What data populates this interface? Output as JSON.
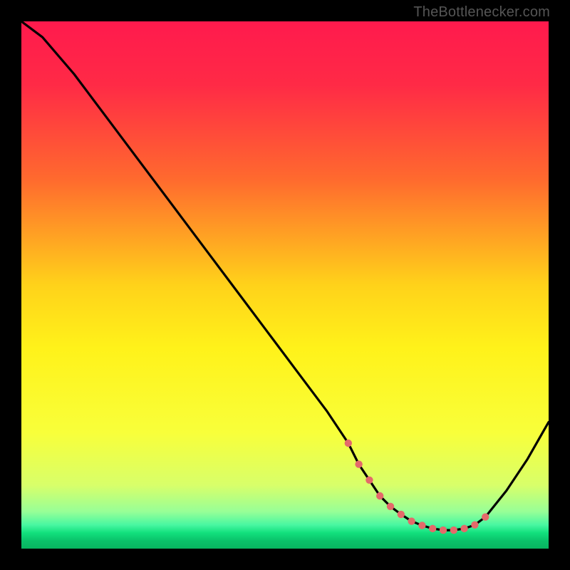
{
  "watermark": "TheBottlenecker.com",
  "chart_data": {
    "type": "line",
    "title": "",
    "xlabel": "",
    "ylabel": "",
    "xlim": [
      0,
      100
    ],
    "ylim": [
      0,
      100
    ],
    "gradient_stops": [
      {
        "pos": 0.0,
        "color": "#ff1a4d"
      },
      {
        "pos": 0.12,
        "color": "#ff2a46"
      },
      {
        "pos": 0.3,
        "color": "#ff6a2e"
      },
      {
        "pos": 0.5,
        "color": "#ffd21a"
      },
      {
        "pos": 0.62,
        "color": "#fff21a"
      },
      {
        "pos": 0.78,
        "color": "#f8ff3a"
      },
      {
        "pos": 0.88,
        "color": "#d8ff6a"
      },
      {
        "pos": 0.93,
        "color": "#97ff97"
      },
      {
        "pos": 0.955,
        "color": "#48f7a1"
      },
      {
        "pos": 0.97,
        "color": "#12e07d"
      },
      {
        "pos": 0.985,
        "color": "#0ac26a"
      },
      {
        "pos": 1.0,
        "color": "#08b560"
      }
    ],
    "series": [
      {
        "name": "curve",
        "x": [
          0,
          4,
          10,
          16,
          22,
          28,
          34,
          40,
          46,
          52,
          58,
          62,
          64,
          66,
          68,
          70,
          72,
          74,
          76,
          78,
          80,
          82,
          84,
          86,
          88,
          92,
          96,
          100
        ],
        "y": [
          100,
          97,
          90,
          82,
          74,
          66,
          58,
          50,
          42,
          34,
          26,
          20,
          16,
          13,
          10,
          8,
          6.5,
          5.2,
          4.4,
          3.8,
          3.5,
          3.5,
          3.8,
          4.5,
          6,
          11,
          17,
          24
        ]
      }
    ],
    "markers": {
      "color": "#e46a6a",
      "radius": 5.2,
      "points_x": [
        62,
        64,
        66,
        68,
        70,
        72,
        74,
        76,
        78,
        80,
        82,
        84,
        86,
        88
      ],
      "points_y": [
        20,
        16,
        13,
        10,
        8,
        6.5,
        5.2,
        4.4,
        3.8,
        3.5,
        3.5,
        3.8,
        4.5,
        6
      ]
    }
  }
}
